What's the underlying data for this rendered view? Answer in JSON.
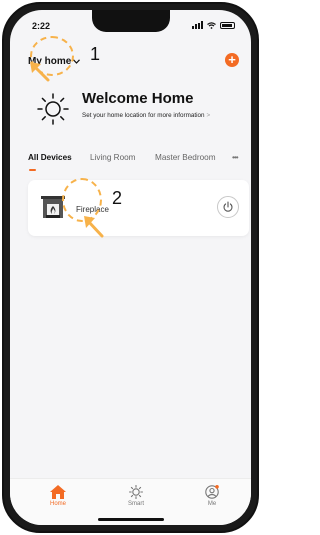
{
  "status_bar": {
    "time": "2:22"
  },
  "header": {
    "home_name": "My home",
    "add_icon": "plus-icon"
  },
  "welcome": {
    "title": "Welcome Home",
    "subtitle": "Set your home location for more information",
    "arrow": ">"
  },
  "room_tabs": {
    "items": [
      {
        "label": "All Devices"
      },
      {
        "label": "Living Room"
      },
      {
        "label": "Master Bedroom"
      }
    ],
    "more": "•••"
  },
  "devices": [
    {
      "name": "Fireplace",
      "icon": "fireplace-icon",
      "power": "off"
    }
  ],
  "bottom_nav": {
    "items": [
      {
        "label": "Home",
        "icon": "home-icon",
        "active": true
      },
      {
        "label": "Smart",
        "icon": "smart-icon",
        "active": false
      },
      {
        "label": "Me",
        "icon": "profile-icon",
        "active": false
      }
    ]
  },
  "annotations": [
    {
      "number": "1"
    },
    {
      "number": "2"
    }
  ],
  "colors": {
    "accent": "#f36b24",
    "annotation": "#f7b24a"
  }
}
